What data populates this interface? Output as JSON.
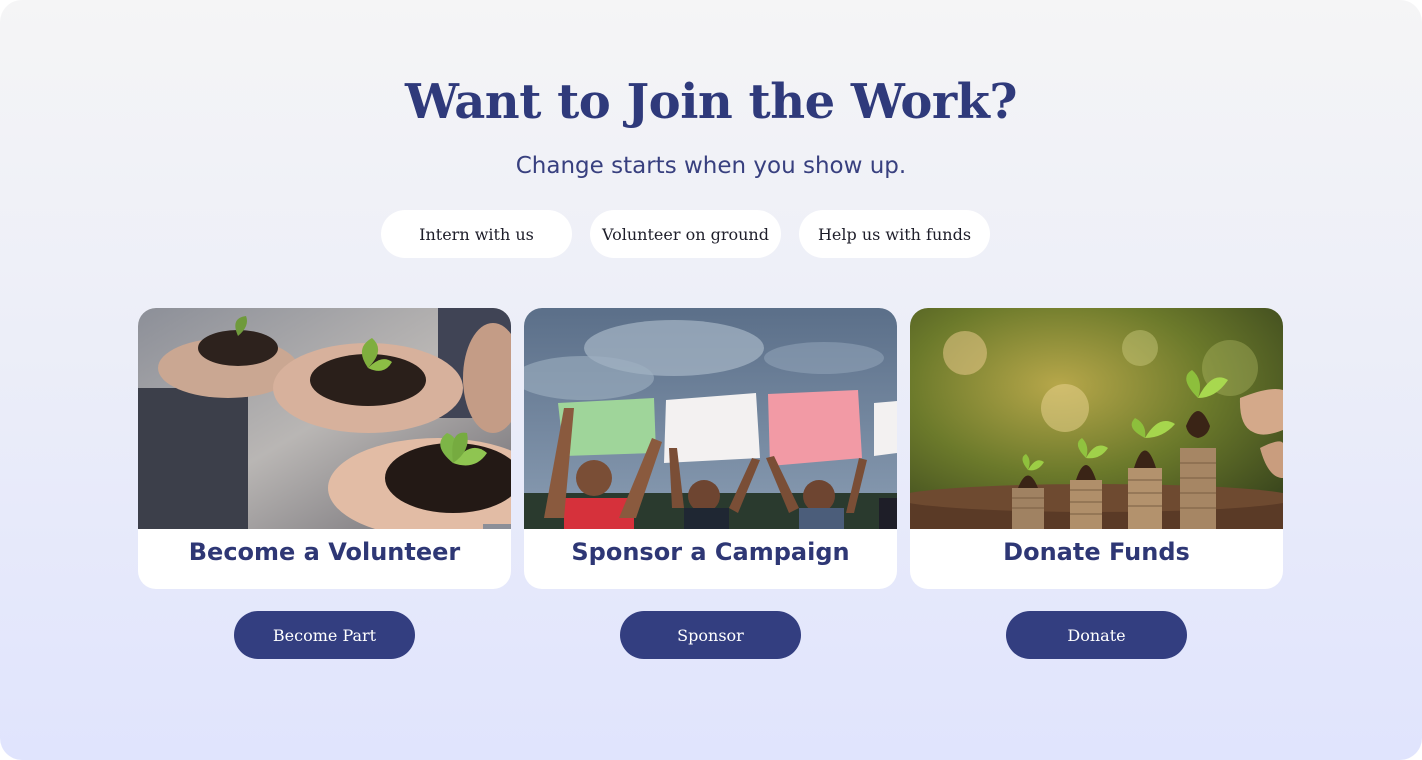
{
  "header": {
    "title": "Want to Join the Work?",
    "subtitle": "Change starts when you show up."
  },
  "pills": [
    {
      "label": "Intern with us"
    },
    {
      "label": "Volunteer on ground"
    },
    {
      "label": "Help us with funds"
    }
  ],
  "cards": [
    {
      "title": "Become a Volunteer",
      "button": "Become Part",
      "image": "hands-holding-seedlings-photo"
    },
    {
      "title": "Sponsor a Campaign",
      "button": "Sponsor",
      "image": "people-holding-blank-signs-photo"
    },
    {
      "title": "Donate Funds",
      "button": "Donate",
      "image": "plants-growing-on-coin-stacks-photo"
    }
  ],
  "colors": {
    "primary": "#333e80",
    "heading": "#2f3a7b",
    "background_top": "#f5f5f6",
    "background_bottom": "#e0e4fd"
  }
}
